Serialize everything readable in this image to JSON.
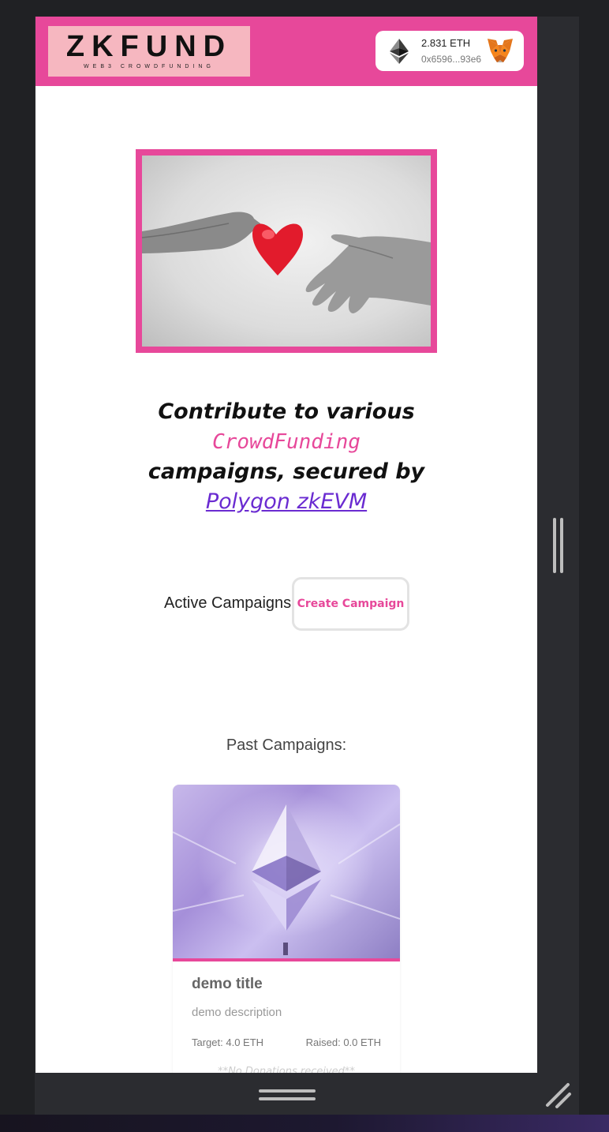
{
  "header": {
    "logo_text": "ZKFUND",
    "logo_subtitle": "WEB3 CROWDFUNDING",
    "wallet": {
      "balance": "2.831 ETH",
      "address": "0x6596...93e6",
      "token_icon": "ethereum-icon",
      "provider_icon": "metamask-fox-icon"
    }
  },
  "hero": {
    "image": "hands-giving-heart"
  },
  "headline": {
    "line1": "Contribute to various",
    "line2": "CrowdFunding",
    "line3": "campaigns, secured by",
    "link": "Polygon zkEVM"
  },
  "campaigns": {
    "active_label": "Active Campaigns:",
    "create_button": "Create Campaign",
    "past_label": "Past Campaigns:",
    "past": [
      {
        "title": "demo title",
        "description": "demo description",
        "target": "Target: 4.0 ETH",
        "raised": "Raised: 0.0 ETH",
        "donations": "**No Donations received**"
      }
    ]
  },
  "colors": {
    "accent": "#e7489a",
    "link": "#6a2bd1",
    "background": "#ffffff",
    "chrome": "#2b2c30"
  }
}
